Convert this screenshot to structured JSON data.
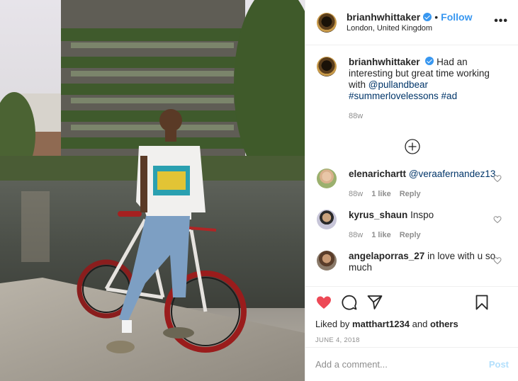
{
  "post": {
    "username": "brianhwhittaker",
    "follow_label": "Follow",
    "separator": "•",
    "location": "London, United Kingdom",
    "more_label": "•••",
    "caption": {
      "text_before": "Had an interesting but great time working with",
      "mention": "@pullandbear",
      "hashtags": "#summerlovelessons #ad",
      "age": "88w"
    },
    "comments": [
      {
        "username": "elenarichartt",
        "text": "@veraafernandez13",
        "age": "88w",
        "likes": "1 like",
        "reply": "Reply"
      },
      {
        "username": "kyrus_shaun",
        "text": "Inspo",
        "age": "88w",
        "likes": "1 like",
        "reply": "Reply"
      },
      {
        "username": "angelaporras_27",
        "text": "in love with u so much"
      }
    ],
    "liked_by_prefix": "Liked by",
    "liked_by_user": "matthart1234",
    "liked_by_joiner": "and",
    "liked_by_others": "others",
    "date": "JUNE 4, 2018",
    "comment_placeholder": "Add a comment...",
    "post_label": "Post"
  },
  "colors": {
    "accent": "#3897f0",
    "like_red": "#ed4956",
    "muted": "#8e8e8e"
  },
  "icons": [
    "verified-badge-icon",
    "more-options-icon",
    "load-more-comments-icon",
    "heart-icon",
    "comment-icon",
    "share-icon",
    "bookmark-icon"
  ]
}
